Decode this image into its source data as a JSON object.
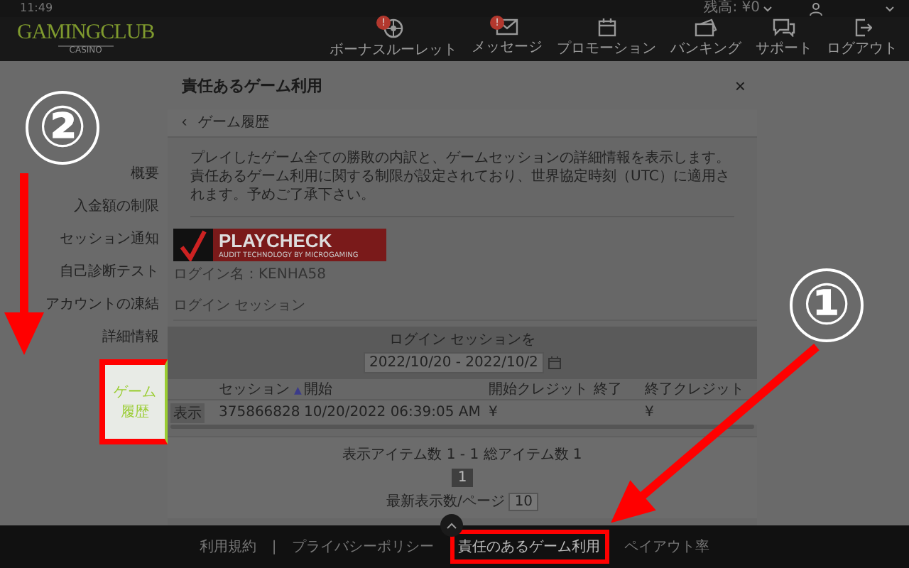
{
  "status_bar": {
    "time": "11:49",
    "balance": "残高: ¥0"
  },
  "header": {
    "logo": "GAMINGCLUB",
    "logo_sub": "CASINO",
    "nav": [
      {
        "label": "ボーナスルーレット",
        "kind": "roulette",
        "badge": "!"
      },
      {
        "label": "メッセージ",
        "kind": "mail",
        "badge": "!"
      },
      {
        "label": "プロモーション",
        "kind": "calendar"
      },
      {
        "label": "バンキング",
        "kind": "wallet"
      },
      {
        "label": "サポート",
        "kind": "chat"
      },
      {
        "label": "ログアウト",
        "kind": "logout"
      }
    ]
  },
  "dialog": {
    "title": "責任あるゲーム利用",
    "close": "×",
    "sidebar": [
      {
        "label": "概要",
        "selected": false,
        "highlighted": false
      },
      {
        "label": "入金額の制限",
        "selected": false,
        "highlighted": false
      },
      {
        "label": "セッション通知",
        "selected": false,
        "highlighted": false
      },
      {
        "label": "自己診断テスト",
        "selected": false,
        "highlighted": false
      },
      {
        "label": "アカウントの凍結",
        "selected": false,
        "highlighted": false
      },
      {
        "label": "詳細情報",
        "selected": false,
        "highlighted": false
      },
      {
        "label": "ゲーム履歴",
        "selected": true,
        "highlighted": true
      }
    ],
    "panel": {
      "back": "‹",
      "title": "ゲーム履歴",
      "description": "プレイしたゲーム全ての勝敗の内訳と、ゲームセッションの詳細情報を表示します。責任あるゲーム利用に関する制限が設定されており、世界協定時刻（UTC）に適用されます。予めご了承下さい。",
      "playcheck": {
        "name": "PLAYCHECK",
        "tagline": "AUDIT TECHNOLOGY BY MICROGAMING"
      },
      "login_name": "ログイン名：KENHA58",
      "section_title": "ログイン セッション",
      "filter_label": "ログイン セッションを",
      "date_range": "2022/10/20 - 2022/10/2",
      "table": {
        "sort_indicator": "▲",
        "columns": [
          {
            "label": "セッション",
            "sorted": true
          },
          {
            "label": "開始",
            "sorted": false
          },
          {
            "label": "開始クレジット",
            "sorted": false
          },
          {
            "label": "終了",
            "sorted": false
          },
          {
            "label": "終了クレジット",
            "sorted": false
          }
        ],
        "rows": [
          {
            "action": "表示",
            "cells": [
              "375866828",
              "10/20/2022 06:39:05 AM",
              "¥",
              "",
              "¥"
            ]
          }
        ]
      },
      "pagination": {
        "summary": "表示アイテム数 1 - 1 総アイテム数 1",
        "pages": [
          {
            "label": "1",
            "selected": true
          }
        ],
        "per_page_label": "最新表示数/ページ",
        "per_page": "10"
      }
    }
  },
  "footer": {
    "links": [
      {
        "label": "利用規約",
        "highlighted": false
      },
      {
        "label": "プライバシーポリシー",
        "highlighted": false
      },
      {
        "label": "責任のあるゲーム利用",
        "highlighted": true
      },
      {
        "label": "ペイアウト率",
        "highlighted": false
      }
    ],
    "separator": "|"
  },
  "annotations": [
    {
      "label": "①"
    },
    {
      "label": "②"
    }
  ]
}
